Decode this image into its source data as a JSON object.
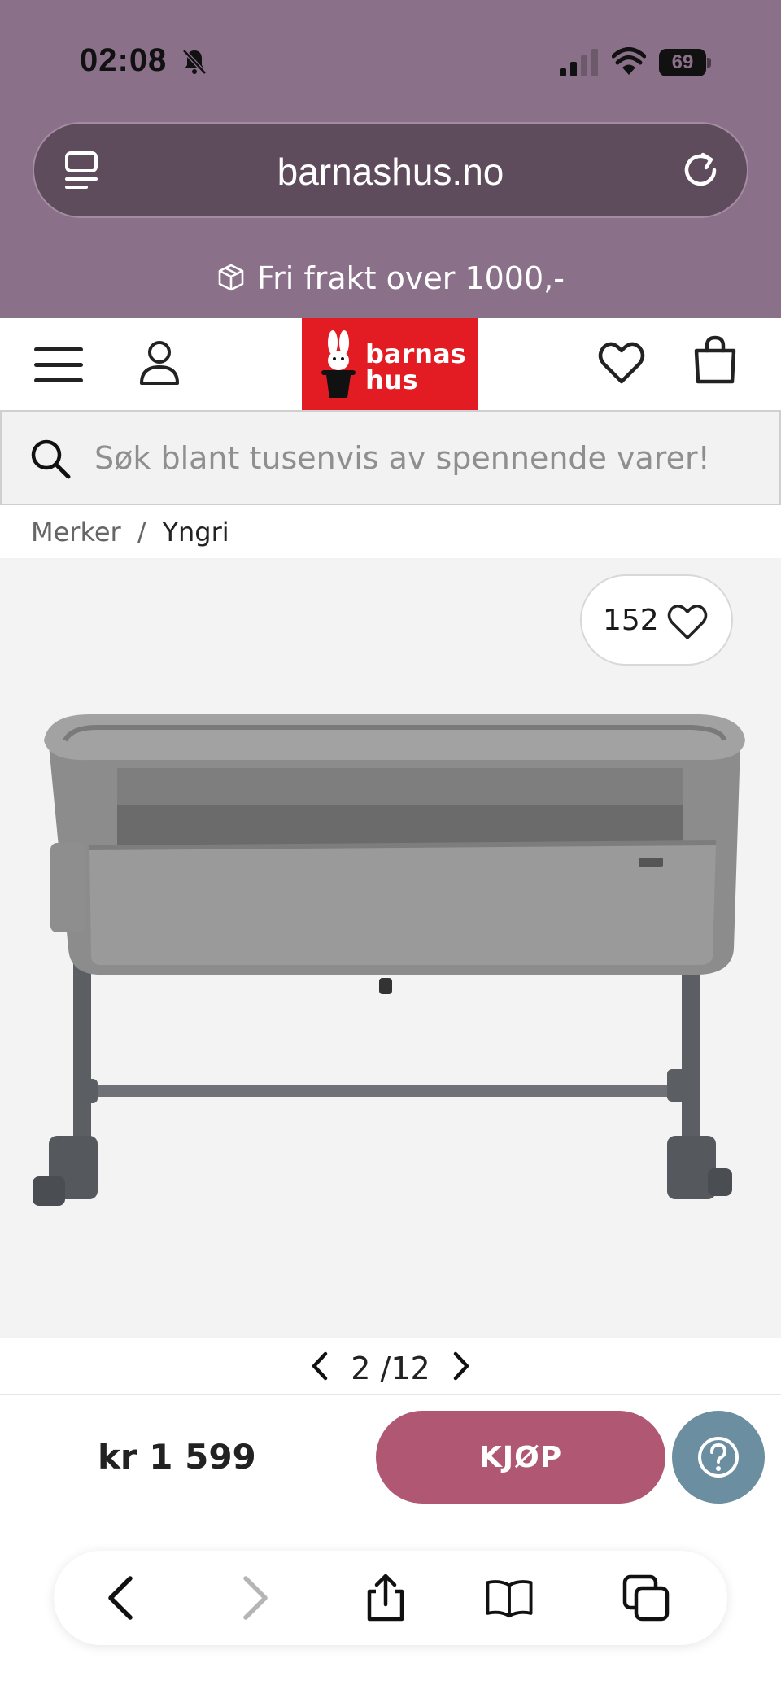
{
  "status_bar": {
    "time": "02:08",
    "battery": "69"
  },
  "browser": {
    "url": "barnashus.no"
  },
  "promo": {
    "text": "Fri frakt over 1000,-"
  },
  "header": {
    "logo_line1": "barnas",
    "logo_line2": "hus"
  },
  "search": {
    "placeholder": "Søk blant tusenvis av spennende varer!"
  },
  "breadcrumb": {
    "items": [
      "Merker",
      "Yngri"
    ],
    "separator": "/"
  },
  "gallery": {
    "wishlist_count": "152",
    "current_page": "2",
    "page_separator": "/",
    "total_pages": "12"
  },
  "buy_bar": {
    "price": "kr 1 599",
    "buy_label": "KJØP"
  },
  "colors": {
    "chrome": "#8b7089",
    "logo": "#e21c22",
    "buy": "#b05873",
    "help": "#6b8ea0"
  }
}
